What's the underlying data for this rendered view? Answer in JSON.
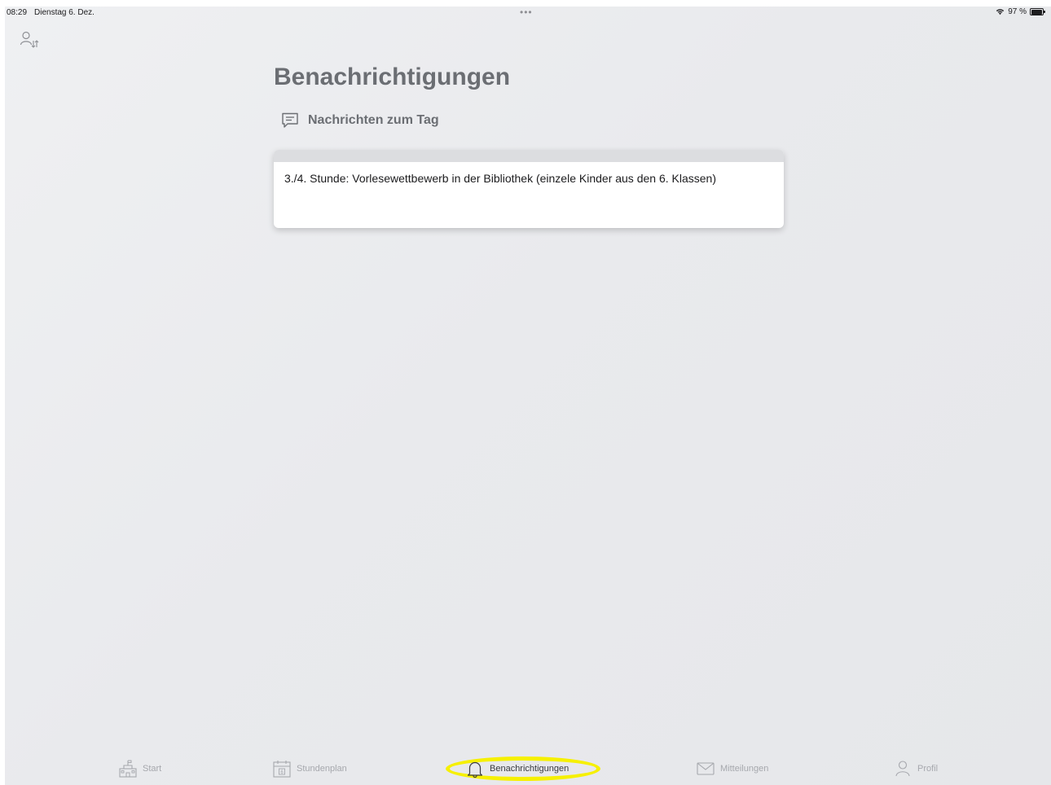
{
  "status_bar": {
    "time": "08:29",
    "date": "Dienstag 6. Dez.",
    "multitask_dots": "•••",
    "battery_percent": "97 %",
    "battery_level": 0.97
  },
  "page": {
    "title": "Benachrichtigungen",
    "section_title": "Nachrichten zum Tag"
  },
  "notifications": [
    {
      "text": "3./4. Stunde: Vorlesewettbewerb in der Bibliothek (einzele Kinder aus den 6. Klassen)"
    }
  ],
  "tabbar": {
    "items": [
      {
        "label": "Start",
        "icon": "school-icon"
      },
      {
        "label": "Stundenplan",
        "icon": "calendar-icon"
      },
      {
        "label": "Benachrichtigungen",
        "icon": "bell-icon",
        "active": true
      },
      {
        "label": "Mitteilungen",
        "icon": "envelope-icon"
      },
      {
        "label": "Profil",
        "icon": "person-icon"
      }
    ],
    "highlight_color": "#f6f000"
  }
}
